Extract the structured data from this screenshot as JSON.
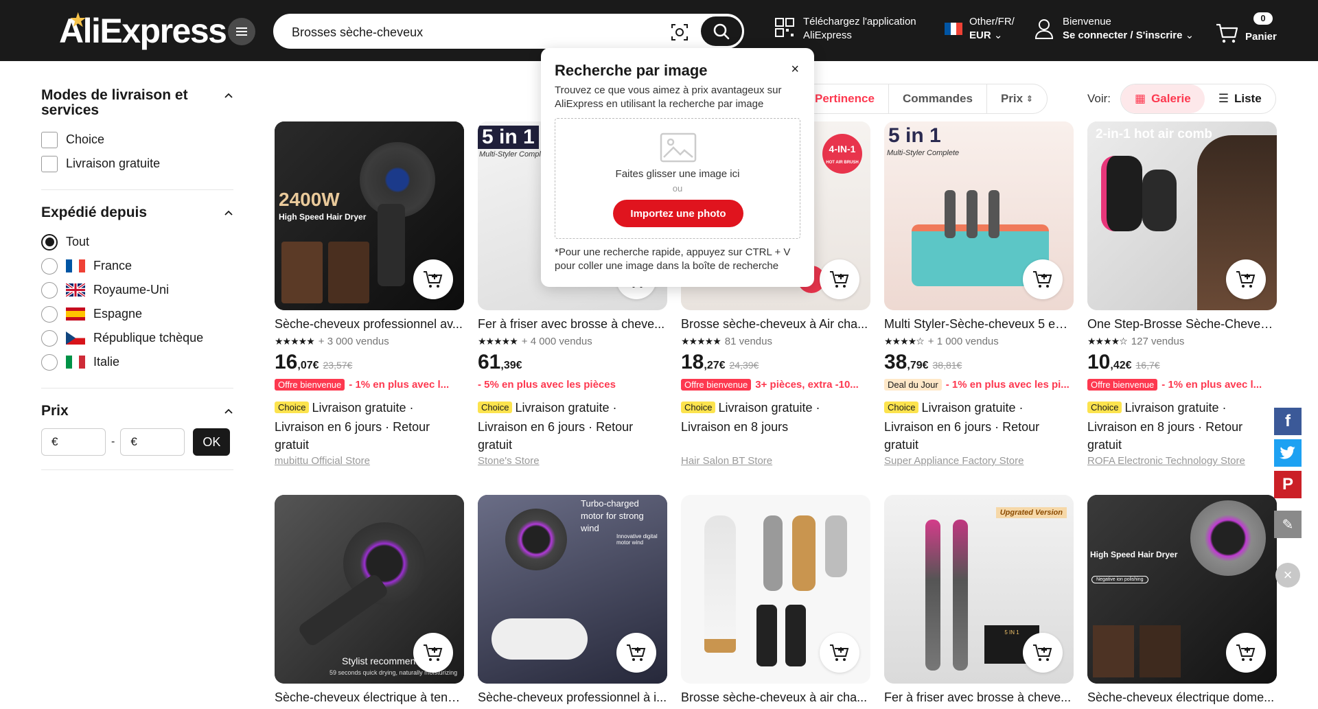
{
  "header": {
    "logo": "AliExpress",
    "search_value": "Brosses sèche-cheveux",
    "app_line1": "Téléchargez l'application",
    "app_line2": "AliExpress",
    "locale_line1": "Other/FR/",
    "locale_currency": "EUR",
    "account_line1": "Bienvenue",
    "account_line2": "Se connecter / S'inscrire",
    "cart_count": "0",
    "cart_label": "Panier"
  },
  "sidebar": {
    "delivery_title": "Modes de livraison et services",
    "delivery_options": [
      "Choice",
      "Livraison gratuite"
    ],
    "ship_from_title": "Expédié depuis",
    "ship_from_options": [
      "Tout",
      "France",
      "Royaume-Uni",
      "Espagne",
      "République tchèque",
      "Italie"
    ],
    "price_title": "Prix",
    "price_min_placeholder": "€",
    "price_max_placeholder": "€",
    "price_sep": "-",
    "ok_label": "OK"
  },
  "sort": {
    "relevance": "Pertinence",
    "orders": "Commandes",
    "price": "Prix",
    "view_label": "Voir:",
    "gallery": "Galerie",
    "list": "Liste"
  },
  "popup": {
    "title": "Recherche par image",
    "close": "×",
    "desc": "Trouvez ce que vous aimez à prix avantageux sur AliExpress en utilisant la recherche par image",
    "drop_text": "Faites glisser une image ici",
    "or": "ou",
    "upload": "Importez une photo",
    "hint": "*Pour une recherche rapide, appuyez sur CTRL + V pour coller une image dans la boîte de recherche"
  },
  "products": [
    {
      "title": "Sèche-cheveux professionnel av...",
      "stars": "★★★★★",
      "sold": "+ 3 000 vendus",
      "price_int": "16",
      "price_dec": ",07€",
      "old": "23,57€",
      "tag": "Offre bienvenue",
      "promo": "- 1% en plus avec l...",
      "ship": "Livraison gratuite · Livraison en 6 jours · Retour gratuit",
      "store": "mubittu Official Store",
      "img_text": "2400W",
      "img_sub": "High Speed Hair Dryer"
    },
    {
      "title": "Fer à friser avec brosse à cheve...",
      "stars": "★★★★★",
      "sold": "+ 4 000 vendus",
      "price_int": "61",
      "price_dec": ",39€",
      "old": "",
      "tag": "",
      "promo": "- 5% en plus avec les pièces",
      "ship": "Livraison gratuite · Livraison en 6 jours · Retour gratuit",
      "store": "Stone's Store",
      "img_text": "5 in 1",
      "img_sub": "Multi-Styler Complete"
    },
    {
      "title": "Brosse sèche-cheveux à Air cha...",
      "stars": "★★★★★",
      "sold": "81 vendus",
      "price_int": "18",
      "price_dec": ",27€",
      "old": "24,39€",
      "tag": "Offre bienvenue",
      "promo": "3+ pièces, extra -10...",
      "ship": "Livraison gratuite · Livraison en 8 jours",
      "store": "Hair Salon BT Store",
      "img_text": "4-IN-1",
      "img_sub": "HOT AIR BRUSH"
    },
    {
      "title": "Multi Styler-Sèche-cheveux 5 en ...",
      "stars": "★★★★☆",
      "sold": "+ 1 000 vendus",
      "price_int": "38",
      "price_dec": ",79€",
      "old": "38,81€",
      "tag": "Deal du Jour",
      "promo": "- 1% en plus avec les pi...",
      "ship": "Livraison gratuite · Livraison en 6 jours · Retour gratuit",
      "store": "Super Appliance Factory Store",
      "img_text": "5 in 1",
      "img_sub": "Multi-Styler Complete"
    },
    {
      "title": "One Step-Brosse Sèche-Cheveu...",
      "stars": "★★★★☆",
      "sold": "127 vendus",
      "price_int": "10",
      "price_dec": ",42€",
      "old": "16,7€",
      "tag": "Offre bienvenue",
      "promo": "- 1% en plus avec l...",
      "ship": "Livraison gratuite · Livraison en 8 jours · Retour gratuit",
      "store": "ROFA Electronic Technology Store",
      "img_text": "2-in-1 hot air comb",
      "img_sub": ""
    },
    {
      "title": "Sèche-cheveux électrique à tens...",
      "img_text": "Stylist recommen...",
      "img_sub": "59 seconds quick drying, naturally moisturizing"
    },
    {
      "title": "Sèche-cheveux professionnel à i...",
      "img_text": "Turbo-charged motor for strong wind",
      "img_sub": "Innovative digital motor wind"
    },
    {
      "title": "Brosse sèche-cheveux à air cha...",
      "img_text": "",
      "img_sub": ""
    },
    {
      "title": "Fer à friser avec brosse à cheve...",
      "img_text": "Upgrated Version",
      "img_sub": "5 IN 1"
    },
    {
      "title": "Sèche-cheveux électrique dome...",
      "img_text": "High Speed Hair Dryer",
      "img_sub": "Negative ion polishing"
    }
  ],
  "choice_badge": "Choice",
  "colors": {
    "accent": "#fd384f",
    "header_bg": "#1a1a1a",
    "upload_btn": "#e0141e",
    "choice_yellow": "#fce34e"
  }
}
